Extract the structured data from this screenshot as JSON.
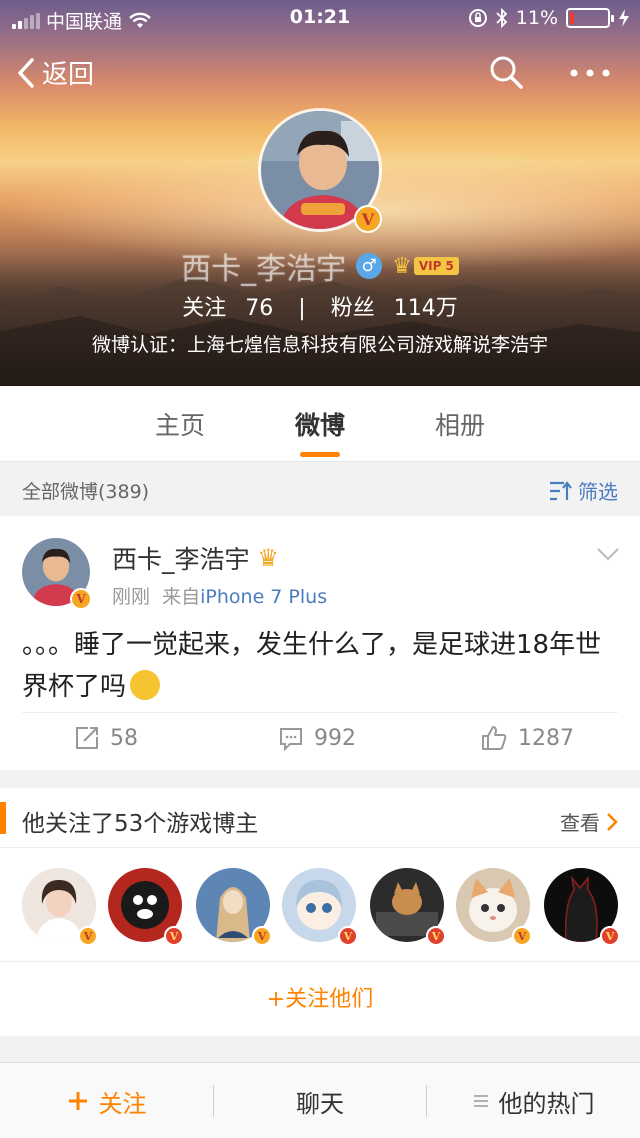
{
  "status_bar": {
    "carrier": "中国联通",
    "time": "01:21",
    "battery": "11%",
    "battery_level": 0.11
  },
  "nav": {
    "back_label": "返回"
  },
  "profile": {
    "name": "西卡_李浩宇",
    "vip_level": "VIP 5",
    "following_label": "关注",
    "following_count": "76",
    "fans_label": "粉丝",
    "fans_count": "114万",
    "verification": "微博认证：上海七煌信息科技有限公司游戏解说李浩宇"
  },
  "tabs": [
    {
      "label": "主页",
      "active": false
    },
    {
      "label": "微博",
      "active": true
    },
    {
      "label": "相册",
      "active": false
    }
  ],
  "filter_bar": {
    "all_label": "全部微博(389)",
    "filter_label": "筛选"
  },
  "post": {
    "author": "西卡_李浩宇",
    "time": "刚刚",
    "source_prefix": "来自",
    "source": "iPhone 7 Plus",
    "text": "。。。睡了一觉起来，发生什么了，是足球进18年世界杯了吗",
    "reposts": "58",
    "comments": "992",
    "likes": "1287"
  },
  "recommend": {
    "title": "他关注了53个游戏博主",
    "more_label": "查看",
    "follow_all_label": "+关注他们",
    "users": [
      {
        "name": "user-1",
        "badge": "gold"
      },
      {
        "name": "user-2",
        "badge": "red"
      },
      {
        "name": "user-3",
        "badge": "gold"
      },
      {
        "name": "user-4",
        "badge": "red"
      },
      {
        "name": "user-5",
        "badge": "red"
      },
      {
        "name": "user-6",
        "badge": "gold"
      },
      {
        "name": "user-7",
        "badge": "red"
      }
    ]
  },
  "bottom_bar": {
    "follow_label": "关注",
    "chat_label": "聊天",
    "hot_label": "他的热门"
  },
  "colors": {
    "accent": "#ff8200",
    "link": "#4a7cc0",
    "verified_gold": "#f6a623",
    "verified_red": "#e0402c"
  }
}
